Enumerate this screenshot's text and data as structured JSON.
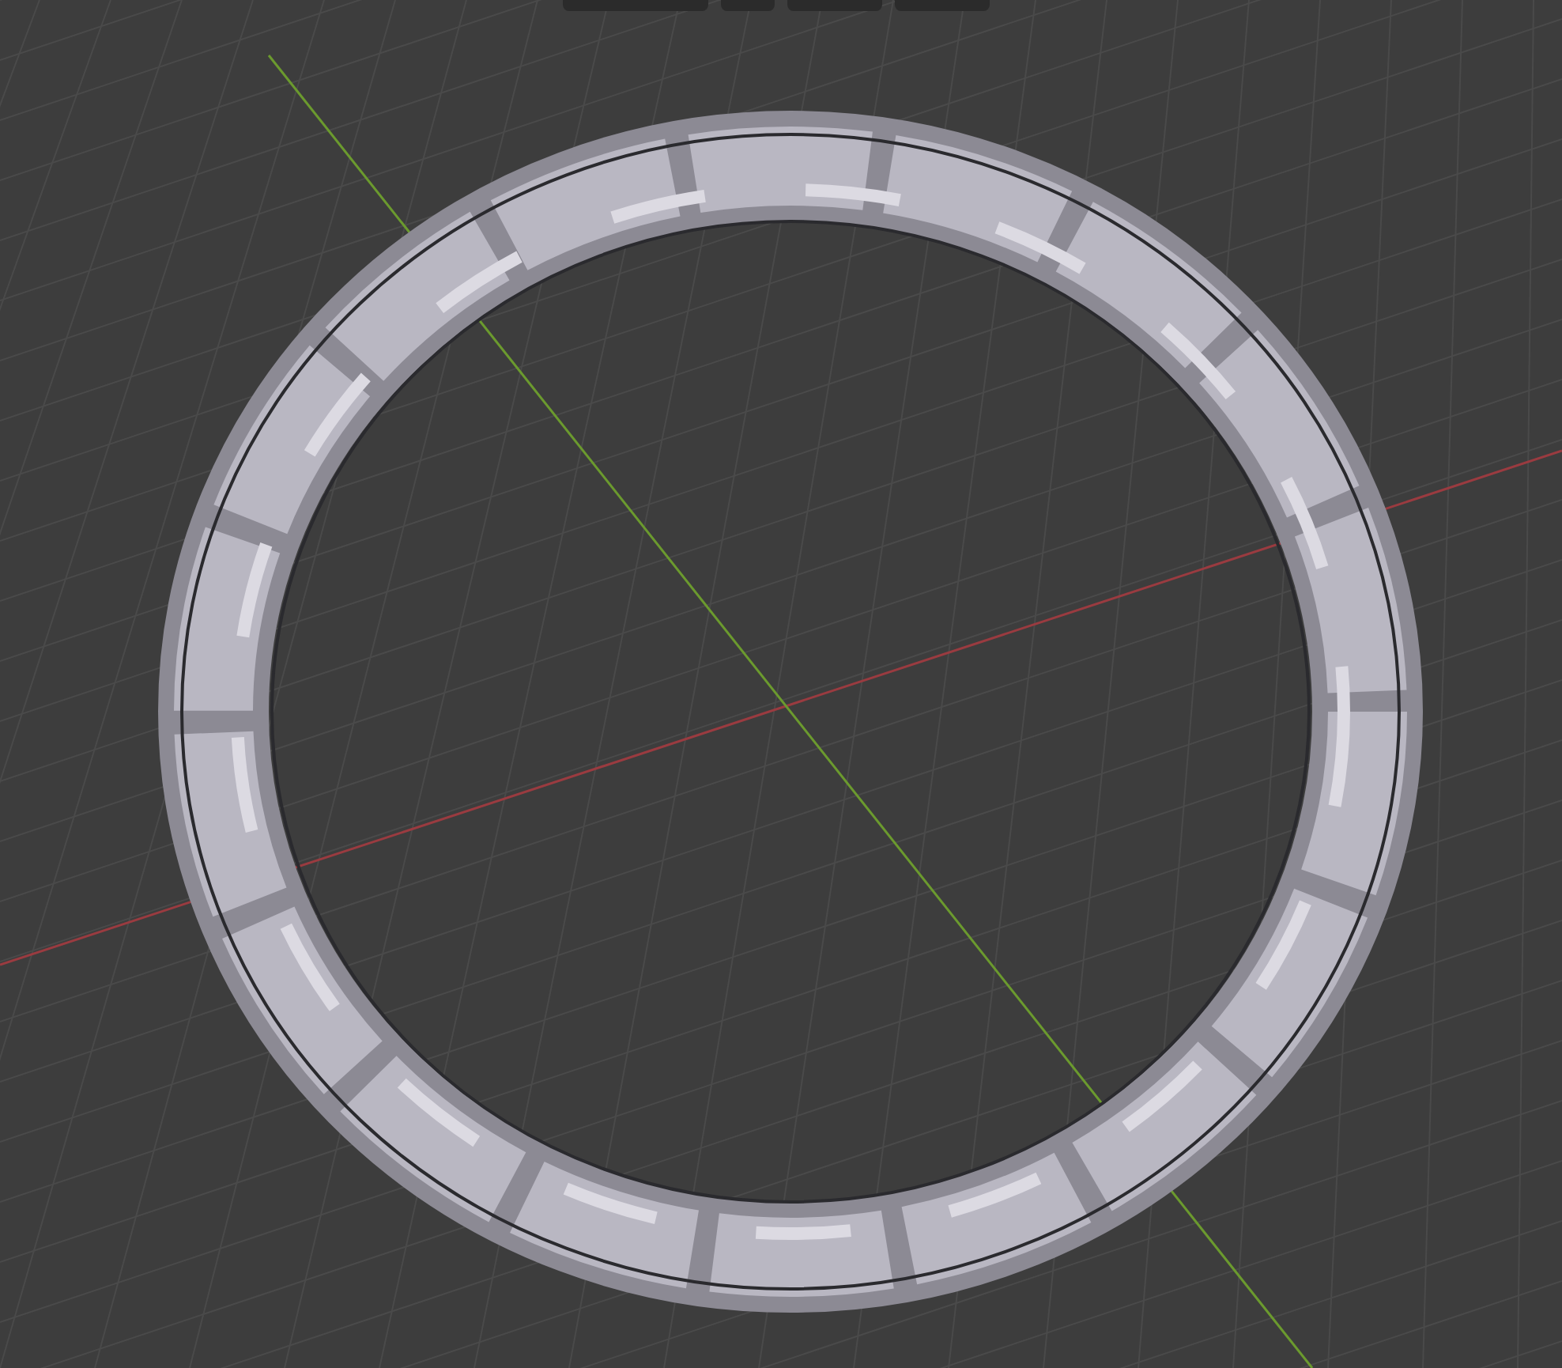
{
  "viewport": {
    "axes": [
      {
        "color": "#9a3b40"
      },
      {
        "color": "#6b9a2e"
      }
    ]
  }
}
